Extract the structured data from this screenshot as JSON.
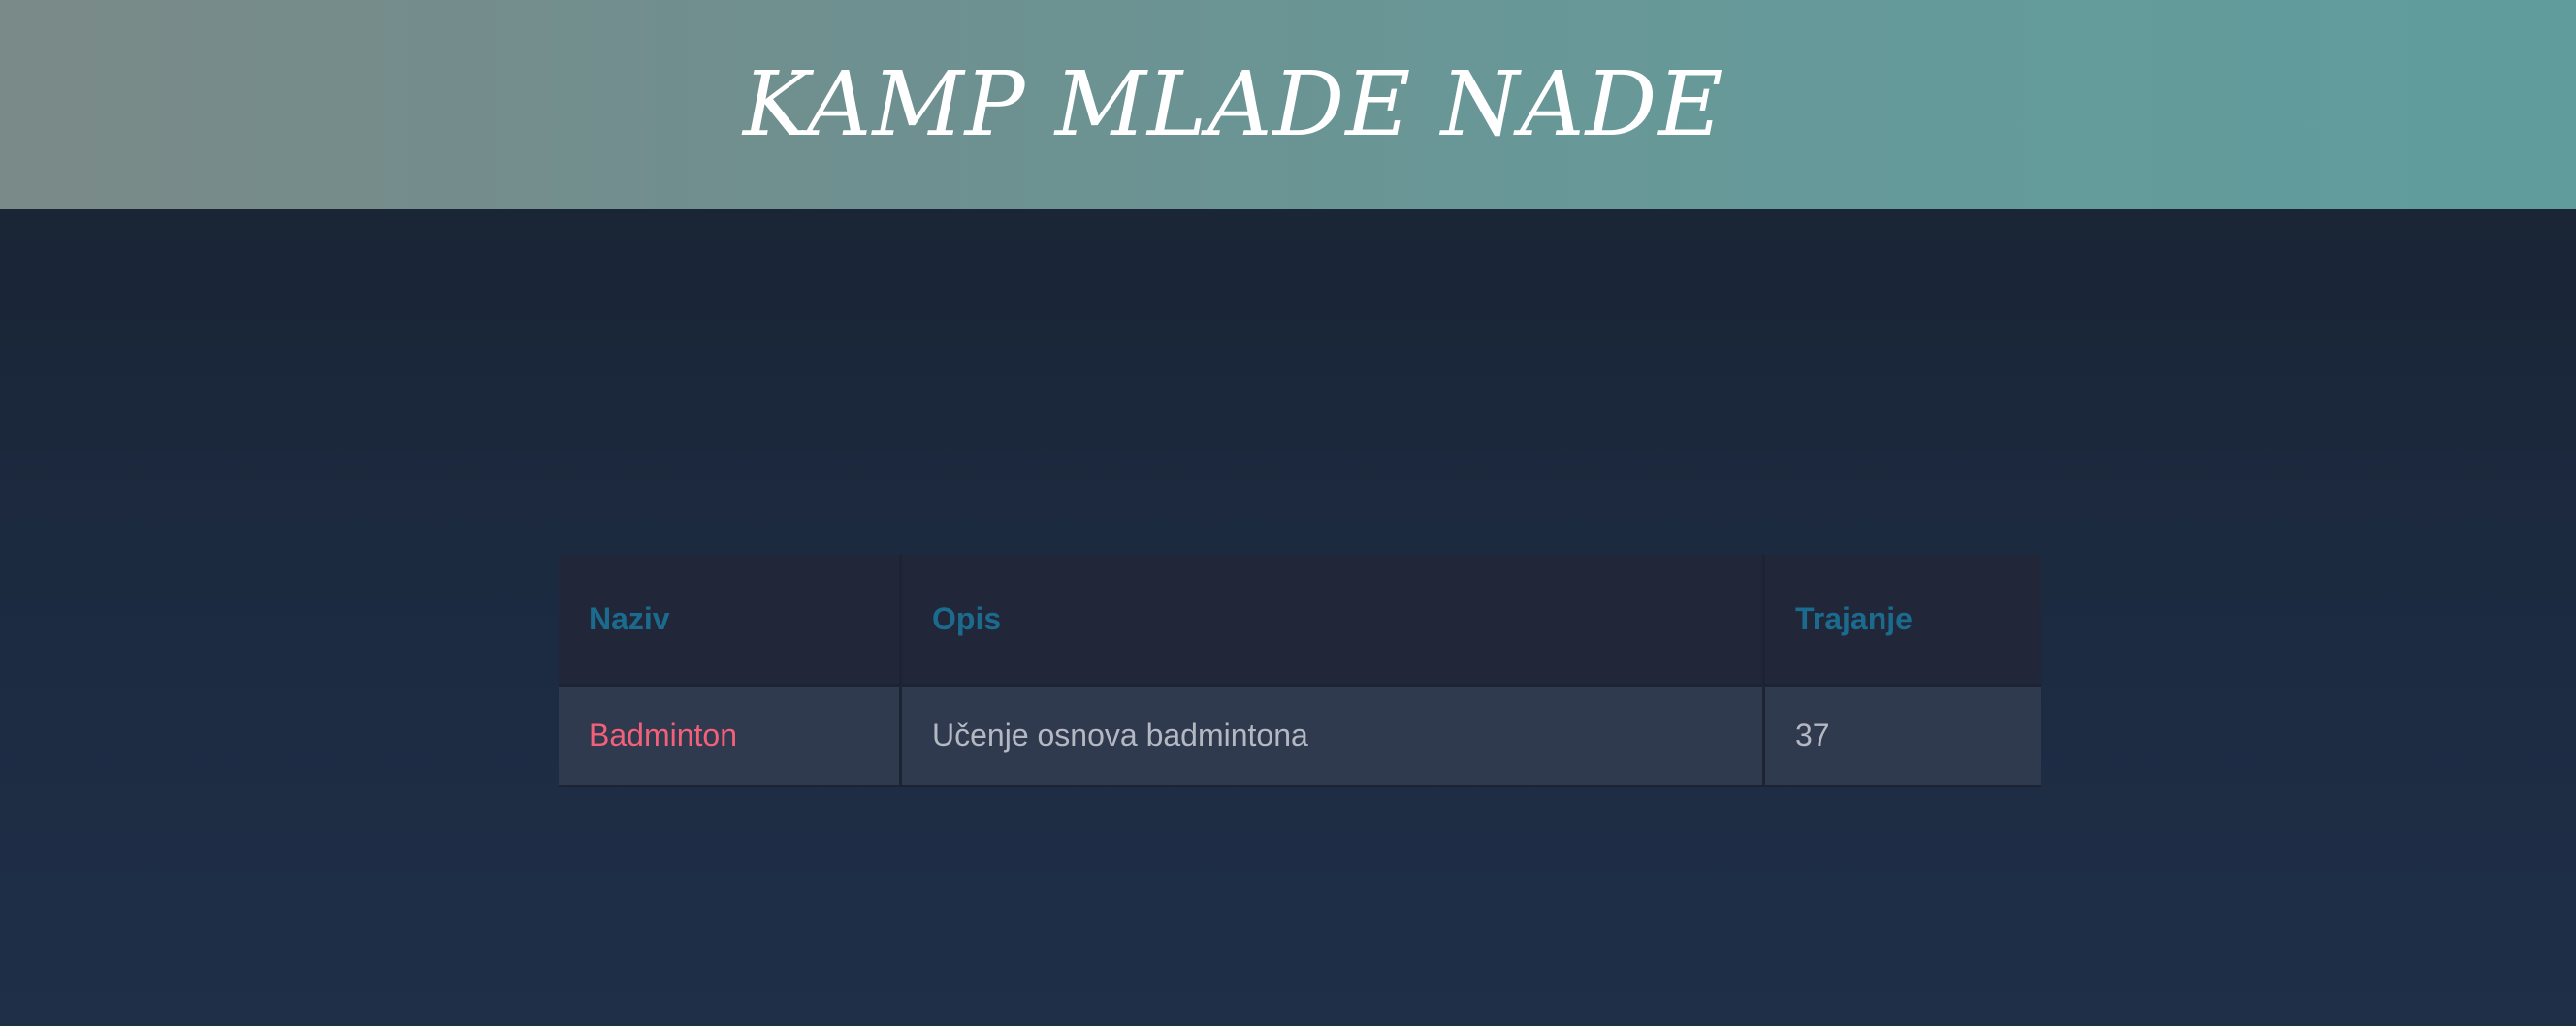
{
  "header": {
    "title": "KAMP MLADE NADE"
  },
  "table": {
    "columns": [
      "Naziv",
      "Opis",
      "Trajanje"
    ],
    "rows": [
      {
        "naziv": "Badminton",
        "opis": "Učenje osnova badmintona",
        "trajanje": "37"
      }
    ]
  },
  "colors": {
    "header_gradient_start": "#7a8a88",
    "header_gradient_end": "#609c9c",
    "page_background": "#1c2a40",
    "header_text": "#1b6b8e",
    "name_text": "#f2607a",
    "cell_text": "#b4b8c2"
  }
}
